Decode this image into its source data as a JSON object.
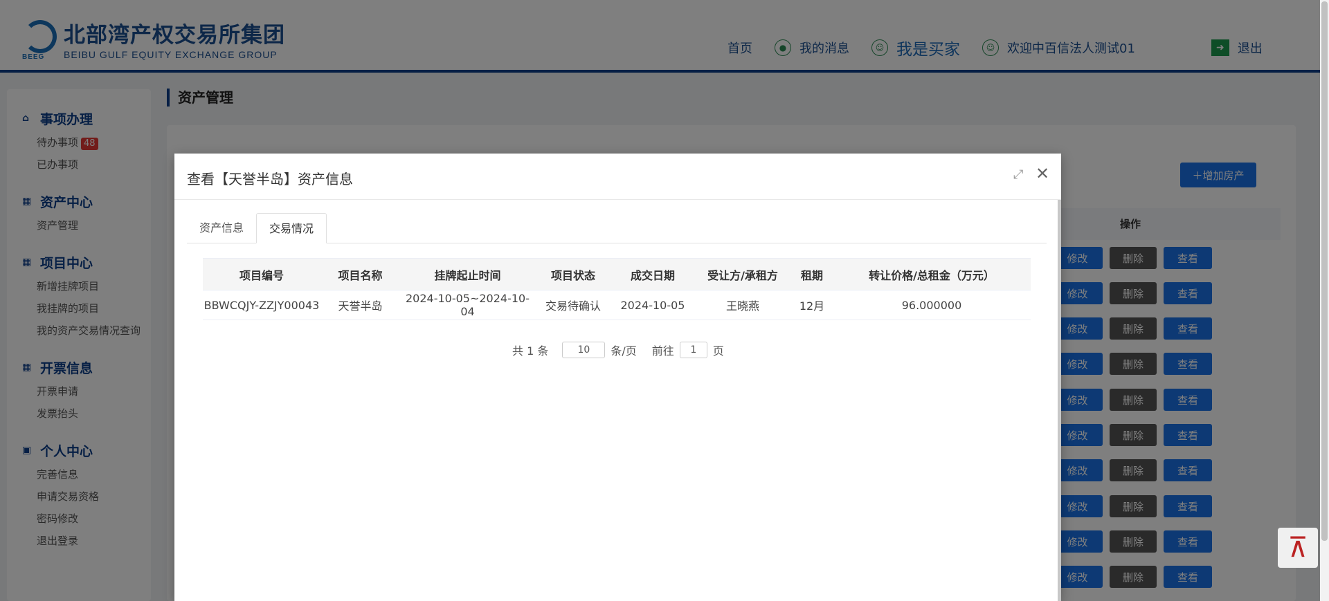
{
  "header": {
    "logo_cn": "北部湾产权交易所集团",
    "logo_en": "BEIBU GULF EQUITY EXCHANGE GROUP",
    "logo_abbr": "BEEG",
    "nav": {
      "home": "首页",
      "messages": "我的消息",
      "buyer": "我是买家",
      "welcome": "欢迎中百信法人测试01",
      "logout": "退出"
    }
  },
  "sidebar": {
    "sections": [
      {
        "title": "事项办理",
        "icon": "home-icon",
        "items": [
          "待办事项",
          "已办事项"
        ],
        "badge": "48"
      },
      {
        "title": "资产中心",
        "icon": "grid-icon",
        "items": [
          "资产管理"
        ]
      },
      {
        "title": "项目中心",
        "icon": "grid-icon",
        "items": [
          "新增挂牌项目",
          "我挂牌的项目",
          "我的资产交易情况查询"
        ]
      },
      {
        "title": "开票信息",
        "icon": "grid-icon",
        "items": [
          "开票申请",
          "发票抬头"
        ]
      },
      {
        "title": "个人中心",
        "icon": "user-book-icon",
        "items": [
          "完善信息",
          "申请交易资格",
          "密码修改",
          "退出登录"
        ]
      }
    ]
  },
  "main": {
    "page_title": "资产管理",
    "add_button": "增加房产",
    "ops_header": "操作",
    "ops": {
      "edit": "修改",
      "delete": "删除",
      "view": "查看"
    }
  },
  "dialog": {
    "title": "查看【天誉半岛】资产信息",
    "tabs": [
      "资产信息",
      "交易情况"
    ],
    "active_tab": "交易情况",
    "table": {
      "headers": [
        "项目编号",
        "项目名称",
        "挂牌起止时间",
        "项目状态",
        "成交日期",
        "受让方/承租方",
        "租期",
        "转让价格/总租金（万元）"
      ],
      "rows": [
        [
          "BBWCQJY-ZZJY00043",
          "天誉半岛",
          "2024-10-05~2024-10-04",
          "交易待确认",
          "2024-10-05",
          "王晓燕",
          "12月",
          "96.000000"
        ]
      ]
    },
    "pager": {
      "total": "共 1 条",
      "page_size": "10",
      "per_page": "条/页",
      "goto": "前往",
      "page": "1",
      "page_unit": "页"
    }
  },
  "colors": {
    "brand": "#0d3f8a",
    "primary": "#1a73e8",
    "badge": "#e53935"
  }
}
